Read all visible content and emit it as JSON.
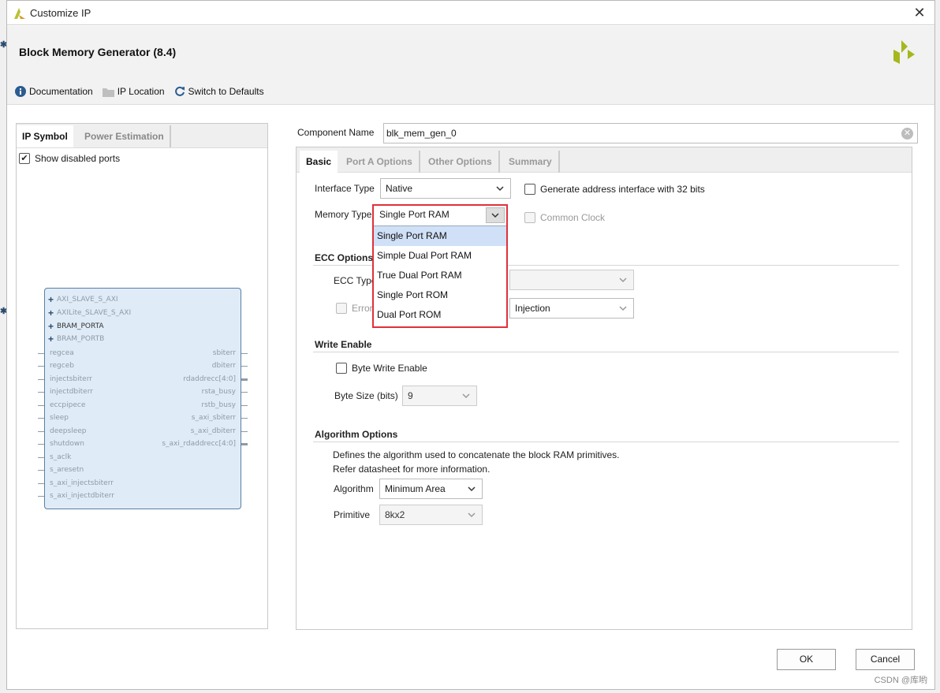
{
  "window": {
    "title": "Customize IP",
    "close_glyph": "✕"
  },
  "header": {
    "ip_name": "Block Memory Generator (8.4)"
  },
  "toolbar": {
    "documentation": "Documentation",
    "ip_location": "IP Location",
    "switch_defaults": "Switch to Defaults"
  },
  "left": {
    "tabs": [
      "IP Symbol",
      "Power Estimation"
    ],
    "show_disabled_ports": "Show disabled ports",
    "show_disabled_checked": true,
    "symbol": {
      "buses": [
        "AXI_SLAVE_S_AXI",
        "AXILite_SLAVE_S_AXI",
        "BRAM_PORTA",
        "BRAM_PORTB"
      ],
      "left_pins": [
        "regcea",
        "regceb",
        "injectsbiterr",
        "injectdbiterr",
        "eccpipece",
        "sleep",
        "deepsleep",
        "shutdown",
        "s_aclk",
        "s_aresetn",
        "s_axi_injectsbiterr",
        "s_axi_injectdbiterr"
      ],
      "right_pins": [
        "sbiterr",
        "dbiterr",
        "rdaddrecc[4:0]",
        "rsta_busy",
        "rstb_busy",
        "s_axi_sbiterr",
        "s_axi_dbiterr",
        "s_axi_rdaddrecc[4:0]"
      ]
    }
  },
  "component": {
    "label": "Component Name",
    "value": "blk_mem_gen_0"
  },
  "right": {
    "tabs": [
      "Basic",
      "Port A Options",
      "Other Options",
      "Summary"
    ],
    "interface_type": {
      "label": "Interface Type",
      "value": "Native"
    },
    "generate_addr": {
      "label": "Generate address interface with 32 bits",
      "checked": false
    },
    "memory_type": {
      "label": "Memory Type",
      "value": "Single Port RAM",
      "options": [
        "Single Port RAM",
        "Simple Dual Port RAM",
        "True Dual Port RAM",
        "Single Port ROM",
        "Dual Port ROM"
      ]
    },
    "common_clock": {
      "label": "Common Clock"
    },
    "ecc": {
      "title": "ECC Options",
      "type_label": "ECC Type",
      "error_label": "Error I",
      "injection_value": "Injection"
    },
    "write_enable": {
      "title": "Write Enable",
      "byte_write": "Byte Write Enable",
      "byte_size_label": "Byte Size (bits)",
      "byte_size_value": "9"
    },
    "algorithm": {
      "title": "Algorithm Options",
      "desc1": "Defines the algorithm used to concatenate the block RAM primitives.",
      "desc2": "Refer datasheet for more information.",
      "algorithm_label": "Algorithm",
      "algorithm_value": "Minimum Area",
      "primitive_label": "Primitive",
      "primitive_value": "8kx2"
    }
  },
  "buttons": {
    "ok": "OK",
    "cancel": "Cancel"
  },
  "watermark": "CSDN @库哟",
  "colors": {
    "highlight_border": "#e0313a",
    "selected_option": "#cfe0f7",
    "symbol_fill": "#dfecf7",
    "xilinx_logo": "#a5b81c"
  }
}
